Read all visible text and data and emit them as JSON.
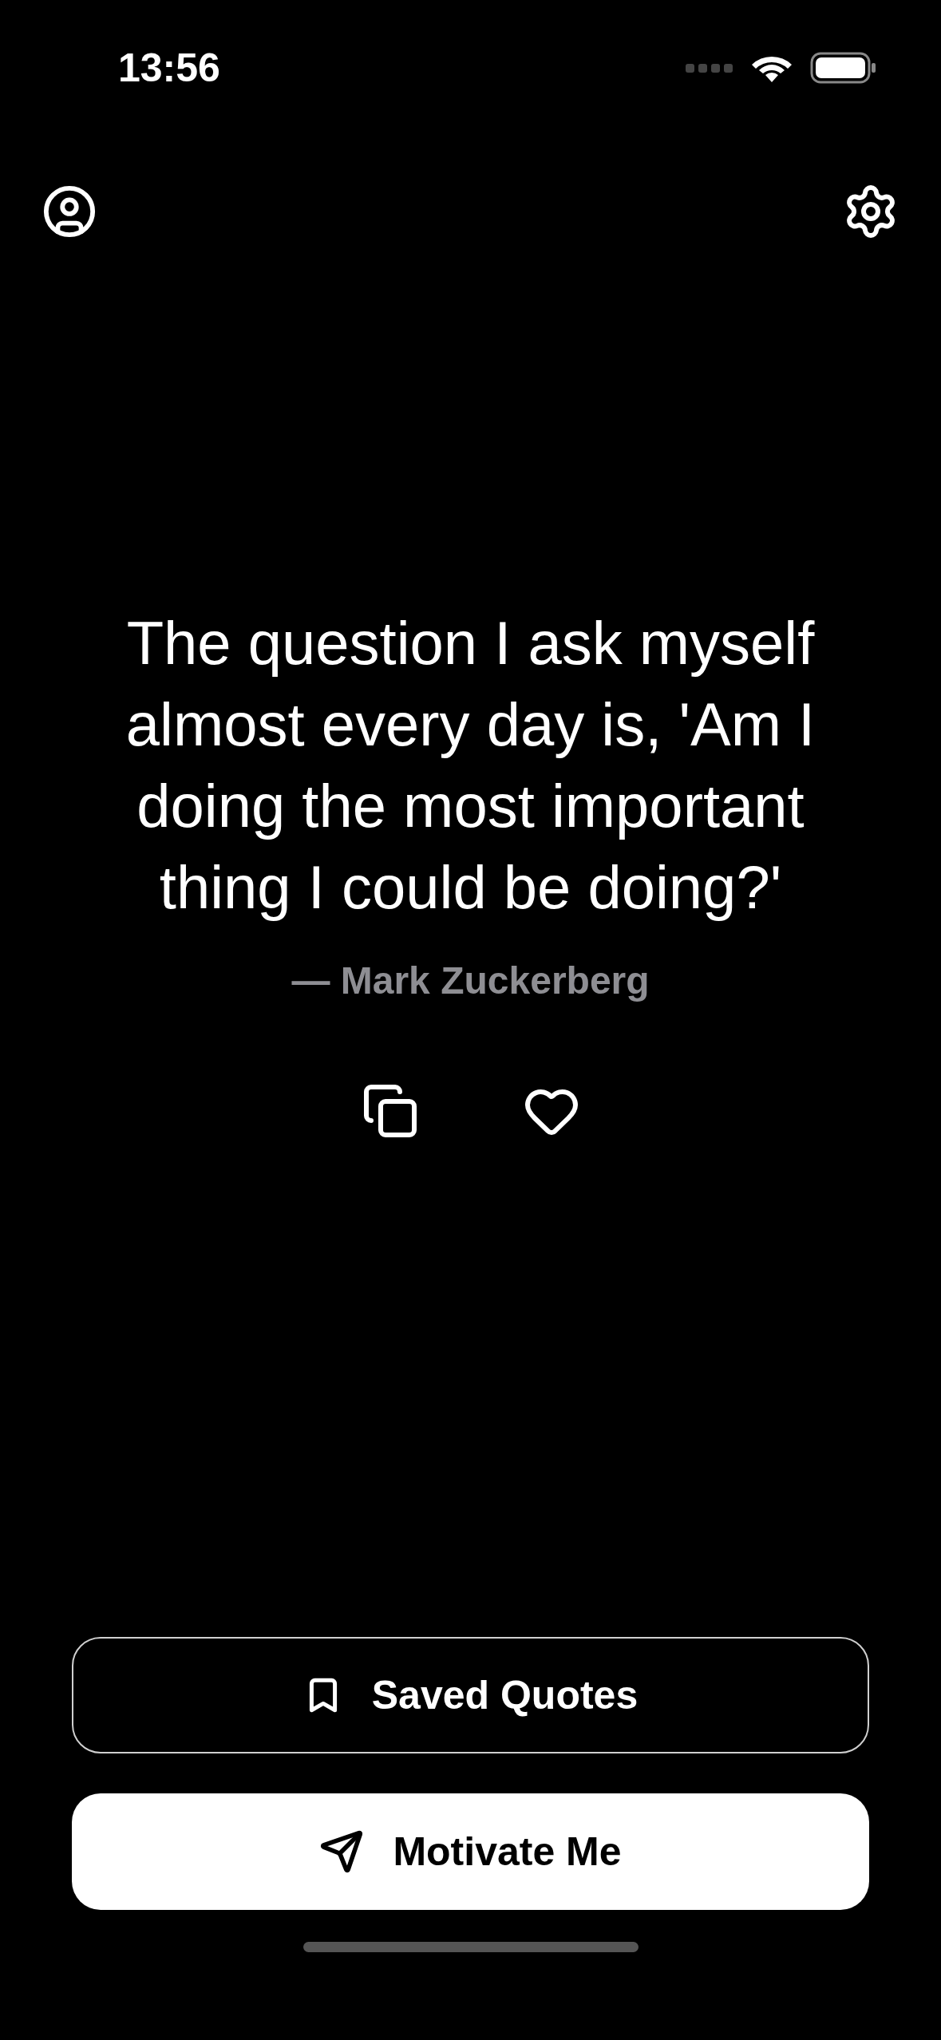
{
  "status_bar": {
    "time": "13:56"
  },
  "quote": {
    "text": "The question I ask myself almost every day is, 'Am I doing the most important thing I could be doing?'",
    "author": "— Mark Zuckerberg",
    "liked": false
  },
  "buttons": [
    {
      "kind": "outline",
      "label": "Saved Quotes"
    },
    {
      "kind": "filled",
      "label": "Motivate Me"
    }
  ]
}
